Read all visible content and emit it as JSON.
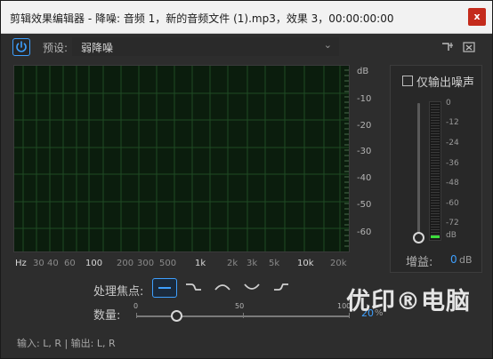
{
  "window": {
    "title": "剪辑效果编辑器 - 降噪: 音频 1，新的音频文件 (1).mp3，效果 3，00:00:00:00",
    "close_glyph": "x"
  },
  "toolbar": {
    "preset_label": "预设:",
    "preset_value": "弱降噪",
    "dropdown_glyph": "⌄"
  },
  "graph": {
    "y_unit": "dB",
    "y_ticks": [
      "-10",
      "-20",
      "-30",
      "-40",
      "-50",
      "-60"
    ],
    "x_unit": "Hz",
    "x_ticks": [
      "30",
      "40",
      "60",
      "100",
      "200",
      "300",
      "500",
      "1k",
      "2k",
      "3k",
      "5k",
      "10k",
      "20k"
    ],
    "x_major": [
      "100",
      "1k",
      "10k"
    ]
  },
  "right_panel": {
    "only_noise_label": "仅输出噪声",
    "only_noise_checked": false,
    "meter_ticks": [
      "0",
      "-12",
      "-24",
      "-36",
      "-48",
      "-60",
      "-72",
      "dB"
    ],
    "gain_label": "增益:",
    "gain_value": "0",
    "gain_unit": "dB"
  },
  "focus": {
    "label": "处理焦点:",
    "options": [
      "flat-icon",
      "low-shelf-icon",
      "mid-peak-icon",
      "mid-notch-icon",
      "high-shelf-icon"
    ],
    "selected": 0
  },
  "amount": {
    "label": "数量:",
    "min": "0",
    "mid": "50",
    "max": "100",
    "value": "20",
    "value_fraction": 0.2,
    "unit": "%"
  },
  "watermark": "优印®电脑",
  "status": "输入: L, R | 输出: L, R",
  "colors": {
    "accent": "#3ea0ff",
    "close": "#c42b1c",
    "graph_bg": "#0b1d0d",
    "grid": "#1f4a24",
    "meter_green": "#3cdc3c"
  }
}
